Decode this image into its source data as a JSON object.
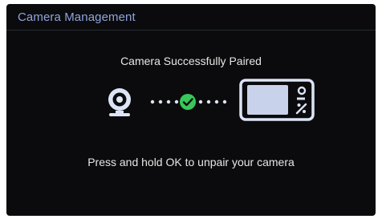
{
  "header": {
    "title": "Camera Management"
  },
  "pairing": {
    "status_title": "Camera Successfully Paired",
    "instruction": "Press and hold OK to unpair your camera",
    "icons": {
      "camera": "webcam-icon",
      "connector": "dots-connector",
      "check": "check-circle-icon",
      "monitor": "baby-monitor-icon"
    }
  },
  "colors": {
    "background": "#0b0b0d",
    "header_title": "#8fa4dc",
    "icon_light": "#dce4f5",
    "icon_fill": "#c8d2ea",
    "success": "#38c75a"
  }
}
